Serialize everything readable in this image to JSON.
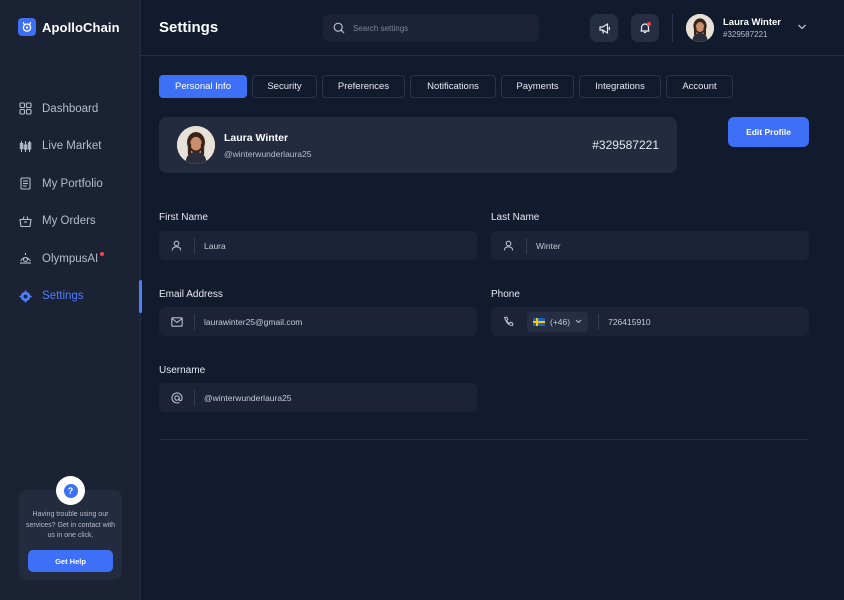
{
  "brand": {
    "name": "ApolloChain"
  },
  "sidebar": {
    "items": [
      {
        "label": "Dashboard",
        "icon": "grid-icon"
      },
      {
        "label": "Live Market",
        "icon": "candlestick-icon"
      },
      {
        "label": "My Portfolio",
        "icon": "document-icon"
      },
      {
        "label": "My Orders",
        "icon": "basket-icon"
      },
      {
        "label": "OlympusAI",
        "icon": "ai-icon",
        "badge": true
      },
      {
        "label": "Settings",
        "icon": "gear-icon",
        "active": true
      }
    ],
    "help": {
      "text": "Having trouble using our services? Get in contact with us in one click.",
      "button": "Get Help"
    }
  },
  "header": {
    "title": "Settings",
    "search_placeholder": "Search settings",
    "user": {
      "name": "Laura Winter",
      "id": "#329587221"
    }
  },
  "tabs": [
    {
      "label": "Personal Info",
      "active": true
    },
    {
      "label": "Security"
    },
    {
      "label": "Preferences"
    },
    {
      "label": "Notifications"
    },
    {
      "label": "Payments"
    },
    {
      "label": "Integrations"
    },
    {
      "label": "Account"
    }
  ],
  "profile": {
    "name": "Laura Winter",
    "handle": "@winterwunderlaura25",
    "id": "#329587221",
    "edit_label": "Edit Profile"
  },
  "form": {
    "first_name": {
      "label": "First Name",
      "value": "Laura"
    },
    "last_name": {
      "label": "Last Name",
      "value": "Winter"
    },
    "email": {
      "label": "Email Address",
      "value": "laurawinter25@gmail.com"
    },
    "phone": {
      "label": "Phone",
      "country_code": "(+46)",
      "value": "726415910"
    },
    "username": {
      "label": "Username",
      "value": "@winterwunderlaura25"
    }
  },
  "colors": {
    "accent": "#3d6ff7",
    "background": "#121a2e",
    "sidebar": "#1b2234",
    "notification": "#f0474b"
  }
}
